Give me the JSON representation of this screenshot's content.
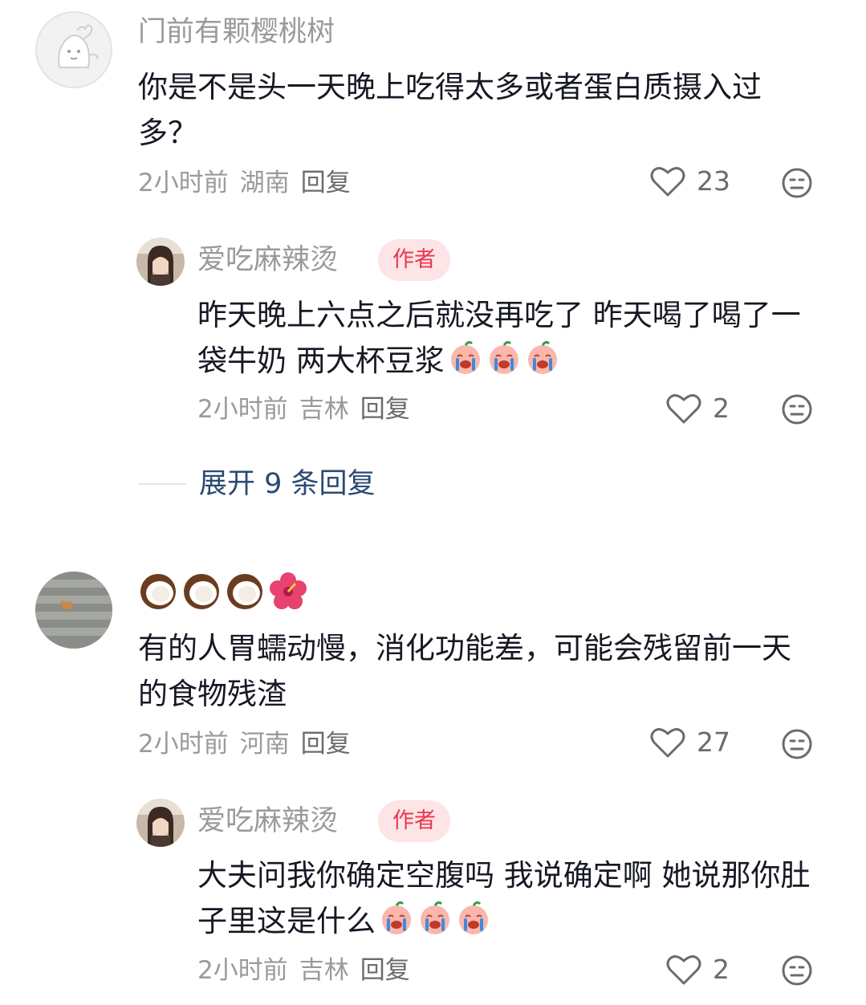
{
  "comments": [
    {
      "username": "门前有颗樱桃树",
      "text": "你是不是头一天晚上吃得太多或者蛋白质摄入过多？",
      "time": "2小时前",
      "location": "湖南",
      "reply_label": "回复",
      "likes": "23",
      "avatar": "cartoon-sketch-avatar",
      "reply": {
        "username": "爱吃麻辣烫",
        "badge": "作者",
        "text": "昨天晚上六点之后就没再吃了 昨天喝了喝了一袋牛奶 两大杯豆浆",
        "emoji": "crying-peach-emoji",
        "time": "2小时前",
        "location": "吉林",
        "reply_label": "回复",
        "likes": "2"
      }
    },
    {
      "username_emoji": [
        "coconut",
        "coconut",
        "coconut",
        "hibiscus"
      ],
      "text": "有的人胃蠕动慢，消化功能差，可能会残留前一天的食物残渣",
      "time": "2小时前",
      "location": "河南",
      "reply_label": "回复",
      "likes": "27",
      "avatar": "stairs-cat-photo-avatar",
      "reply": {
        "username": "爱吃麻辣烫",
        "badge": "作者",
        "text": "大夫问我你确定空腹吗 我说确定啊 她说那你肚子里这是什么",
        "emoji": "crying-peach-emoji",
        "time": "2小时前",
        "location": "吉林",
        "reply_label": "回复",
        "likes": "2"
      }
    }
  ],
  "expand_replies": "展开 9 条回复",
  "colors": {
    "badge_bg": "#fde4e6",
    "badge_text": "#e8394c",
    "link": "#2b4a73",
    "muted": "#9a9a9a"
  }
}
